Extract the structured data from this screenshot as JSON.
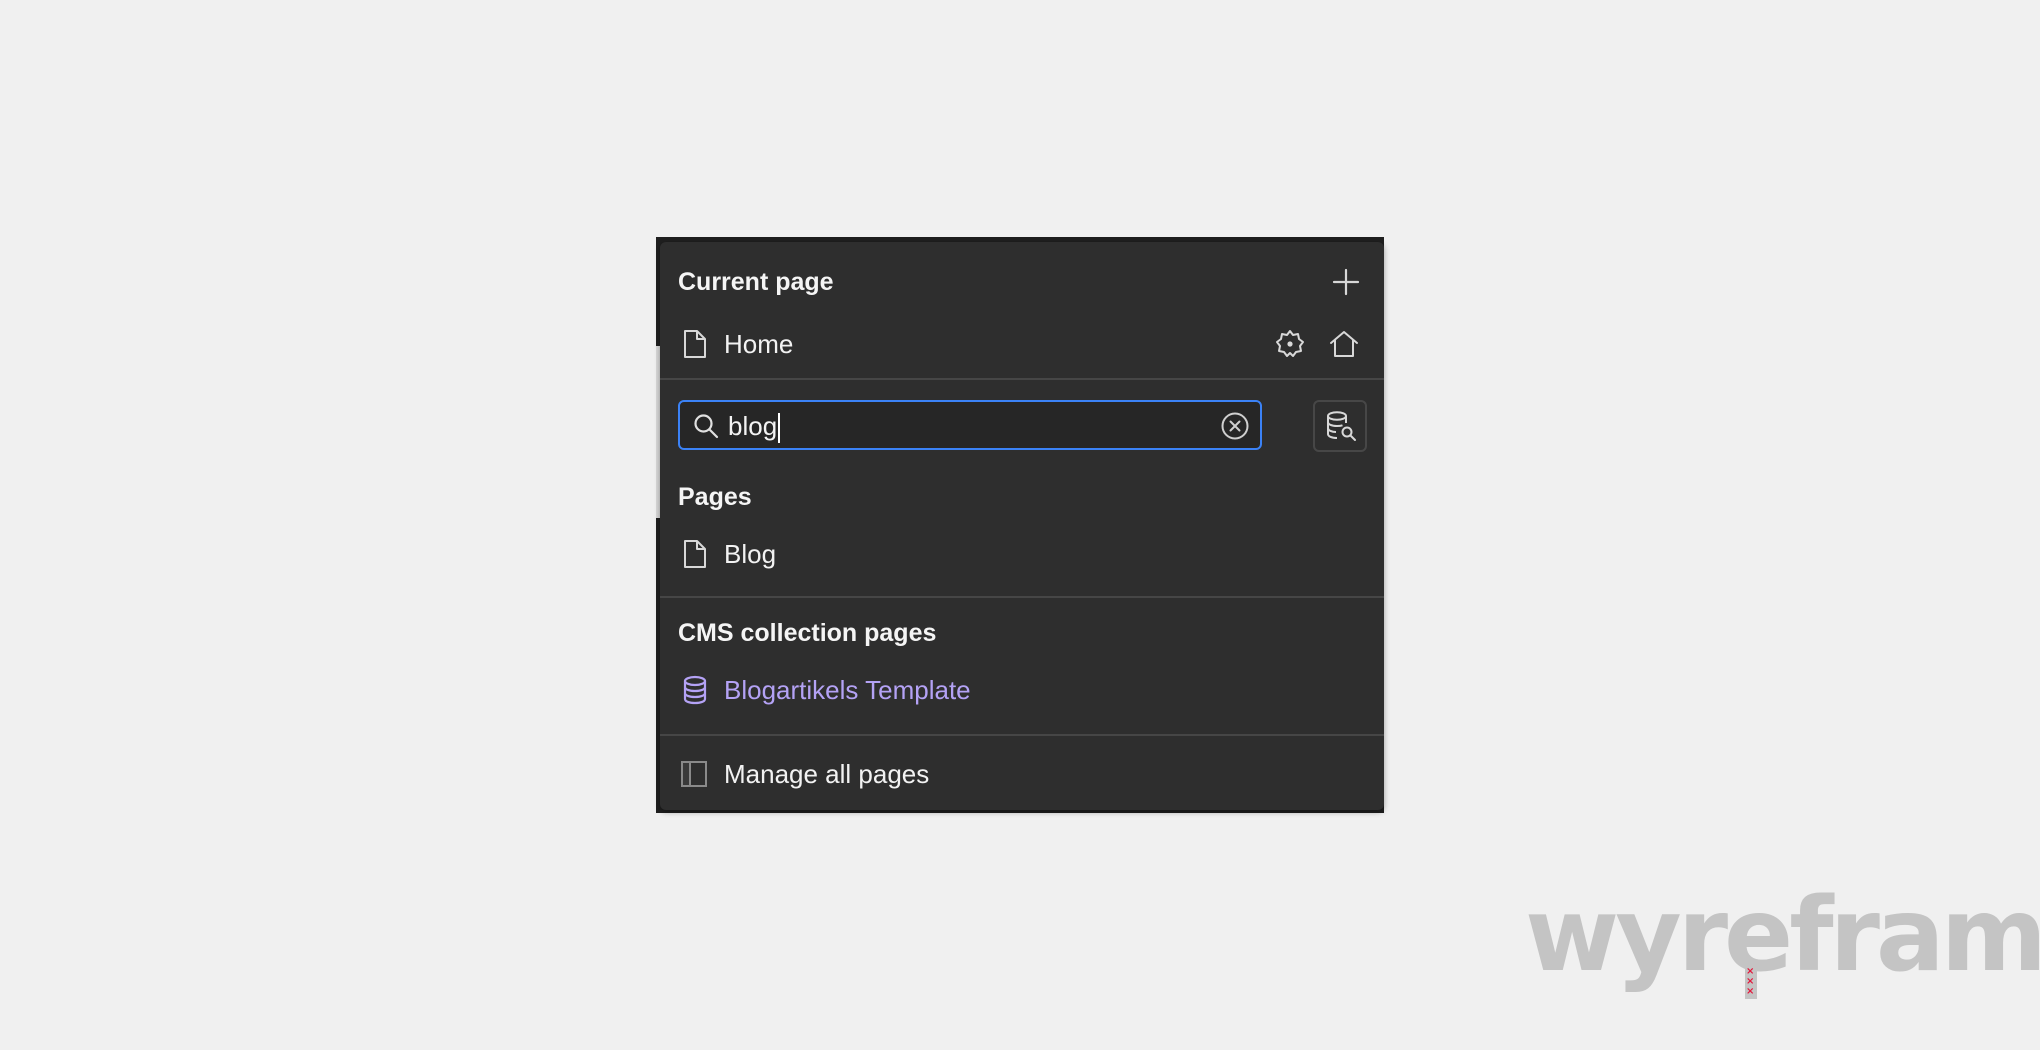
{
  "panel": {
    "current_page": {
      "title": "Current page",
      "add_icon": "plus-icon",
      "page": {
        "label": "Home",
        "icon": "page-icon"
      },
      "settings_icon": "gear-icon",
      "home_icon": "home-icon"
    },
    "search": {
      "value": "blog",
      "search_icon": "search-icon",
      "clear_icon": "clear-icon",
      "cms_search_icon": "database-search-icon"
    },
    "pages": {
      "title": "Pages",
      "items": [
        {
          "label": "Blog",
          "icon": "page-icon"
        }
      ]
    },
    "cms": {
      "title": "CMS collection pages",
      "items": [
        {
          "label": "Blogartikels Template",
          "icon": "database-icon",
          "color": "#b4a2f5"
        }
      ]
    },
    "footer": {
      "label": "Manage all pages",
      "icon": "panel-icon"
    }
  },
  "watermark": {
    "text": "wyreframe",
    "color": "#c4c4c4",
    "accent": "#e4163a"
  },
  "colors": {
    "panel_bg": "#2e2e2e",
    "focus_border": "#3b82f6",
    "cms_accent": "#b4a2f5"
  }
}
